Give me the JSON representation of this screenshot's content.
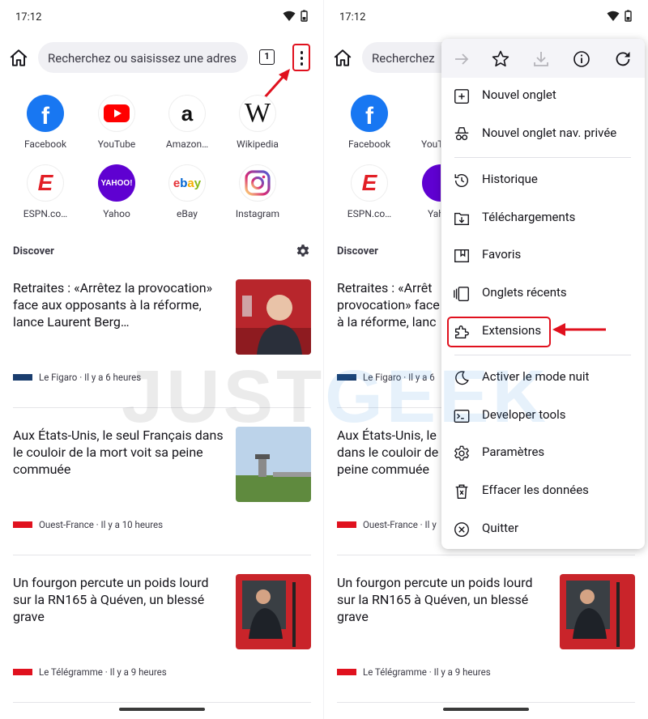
{
  "status": {
    "time": "17:12"
  },
  "toolbar": {
    "url_placeholder": "Recherchez ou saisissez une adres",
    "url_placeholder_short": "Recherchez",
    "tab_count": "1"
  },
  "shortcuts": [
    {
      "label": "Facebook",
      "icon": "facebook-icon"
    },
    {
      "label": "YouTube",
      "icon": "youtube-icon"
    },
    {
      "label": "Amazon…",
      "icon": "amazon-icon"
    },
    {
      "label": "Wikipedia",
      "icon": "wikipedia-icon"
    },
    {
      "label": "ESPN.co…",
      "icon": "espn-icon"
    },
    {
      "label": "Yahoo",
      "icon": "yahoo-icon"
    },
    {
      "label": "eBay",
      "icon": "ebay-icon"
    },
    {
      "label": "Instagram",
      "icon": "instagram-icon"
    }
  ],
  "shortcuts_right": {
    "facebook": "Facebook",
    "youtube": "YouT",
    "espn": "ESPN.co…",
    "yahoo": "Yah"
  },
  "discover": {
    "title": "Discover"
  },
  "stories": [
    {
      "title": "Retraites : «Arrêtez la provocation» face aux opposants à la réforme, lance Laurent Berg…",
      "source": "Le Figaro · Il y a 6 heures",
      "source_short": "Le Figaro · Il y a 6"
    },
    {
      "title": "Aux États-Unis, le seul Français dans le couloir de la mort voit sa peine commuée",
      "source": "Ouest-France · Il y a 10 heures",
      "source_short": "Ouest-France · Il y"
    },
    {
      "title": "Un fourgon percute un poids lourd sur la RN165 à Quéven, un blessé grave",
      "source": "Le Télégramme · Il y a 9 heures",
      "source_short": "Le Télégramme · Il y a 9 heures"
    }
  ],
  "stories_right": [
    {
      "l1": "Retraites : «Arrêt",
      "l2": "provocation» face",
      "l3": "à la réforme, lanc"
    },
    {
      "l1": "Aux États-Unis, le",
      "l2": "dans le couloir de",
      "l3": "peine commuée"
    },
    {
      "l1": "Un fourgon percute un poids lourd",
      "l2": "sur la RN165 à Quéven, un blessé",
      "l3": "grave"
    }
  ],
  "menu": {
    "items": [
      {
        "label": "Nouvel onglet",
        "icon": "new-tab-icon"
      },
      {
        "label": "Nouvel onglet nav. privée",
        "icon": "private-tab-icon"
      },
      {
        "label": "Historique",
        "icon": "history-icon"
      },
      {
        "label": "Téléchargements",
        "icon": "downloads-icon"
      },
      {
        "label": "Favoris",
        "icon": "bookmarks-icon"
      },
      {
        "label": "Onglets récents",
        "icon": "recent-tabs-icon"
      },
      {
        "label": "Extensions",
        "icon": "extensions-icon"
      },
      {
        "label": "Activer le mode nuit",
        "icon": "night-mode-icon"
      },
      {
        "label": "Developer tools",
        "icon": "terminal-icon"
      },
      {
        "label": "Paramètres",
        "icon": "settings-icon"
      },
      {
        "label": "Effacer les données",
        "icon": "clear-data-icon"
      },
      {
        "label": "Quitter",
        "icon": "quit-icon"
      }
    ]
  },
  "watermark": {
    "part1": "JUST",
    "part2": "GEEK"
  },
  "colors": {
    "highlight": "#e0111e",
    "facebook": "#1877f2",
    "youtube": "#ff0000",
    "espn": "#e21f26",
    "yahoo": "#5f01d1"
  }
}
